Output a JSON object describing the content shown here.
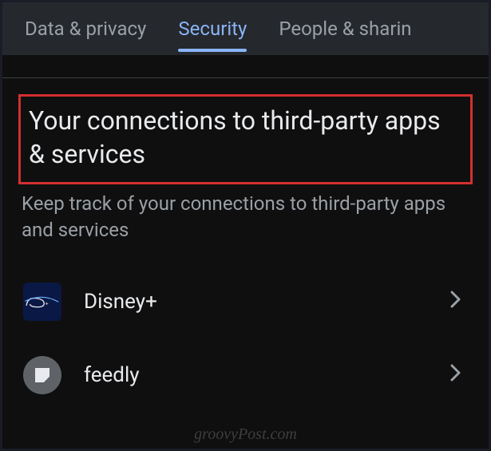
{
  "tabs": {
    "data_privacy": "Data & privacy",
    "security": "Security",
    "people_sharing": "People & sharin"
  },
  "section": {
    "title": "Your connections to third-party apps & services",
    "subtitle": "Keep track of your connections to third-party apps and services"
  },
  "apps": {
    "disney": {
      "name": "Disney+"
    },
    "feedly": {
      "name": "feedly"
    }
  },
  "watermark": "groovyPost.com"
}
